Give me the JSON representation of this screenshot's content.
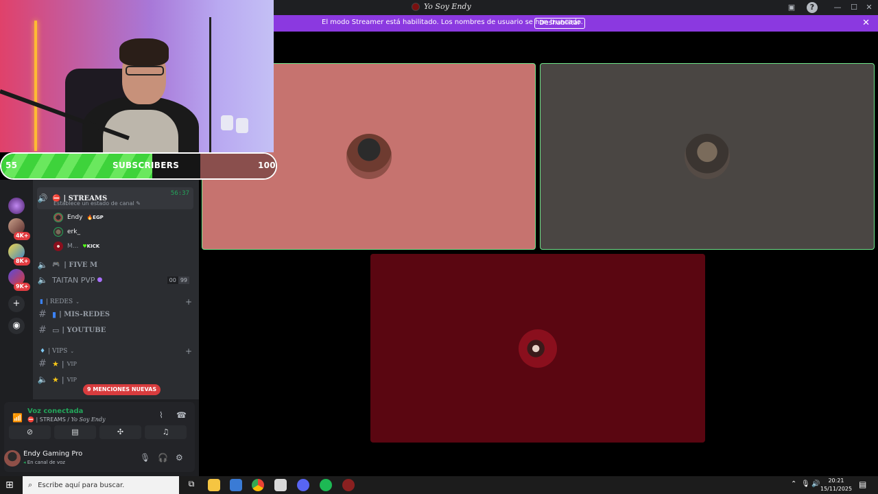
{
  "window": {
    "title": "Yo Soy Endy"
  },
  "banner": {
    "text": "El modo Streamer está habilitado. Los nombres de usuario se han truncado.",
    "button": "Deshabilitar",
    "color": "#8b39e0"
  },
  "overlay": {
    "sub_current": "55",
    "sub_label": "SUBSCRIBERS",
    "sub_goal": "100",
    "progress_fraction": 0.55
  },
  "rail": {
    "badges": [
      "4K+",
      "8K+",
      "9K+"
    ]
  },
  "channels": {
    "active": {
      "name": "| STREAMS",
      "timer": "56:37",
      "status": "Establece un estado de canal"
    },
    "members": [
      {
        "name": "Endy",
        "tag": "EGP",
        "tag_color": "#f2f3f5"
      },
      {
        "name": "erk_",
        "tag": "",
        "tag_color": "#f2f3f5"
      },
      {
        "name": "M...",
        "tag": "KICK",
        "tag_color": "#f2f3f5"
      }
    ],
    "voice_fivem": "| FIVE M",
    "voice_taitan": "TAITAN PVP",
    "taitan_counts": [
      "00",
      "99"
    ],
    "cat_redes": "| REDES",
    "ch_misredes": "| MIS-REDES",
    "ch_youtube": "| YOUTUBE",
    "cat_vips": "| VIPS",
    "ch_vip1": "VIP",
    "ch_vip2": "VIP",
    "mentions": "9 MENCIONES NUEVAS"
  },
  "voice": {
    "title": "Voz conectada",
    "channel": "| STREAMS /",
    "server": "Yo Soy Endy",
    "user_name": "Endy Gaming Pro",
    "user_status": "En canal de voz"
  },
  "taskbar": {
    "search_placeholder": "Escribe aquí para buscar.",
    "time": "20:21",
    "date": "15/11/2025"
  },
  "colors": {
    "speaking_border": "#6ee68a",
    "accent_green": "#23a55a",
    "tile_1": "#c6736f",
    "tile_2": "#4a4643",
    "tile_3": "#5a0611"
  }
}
